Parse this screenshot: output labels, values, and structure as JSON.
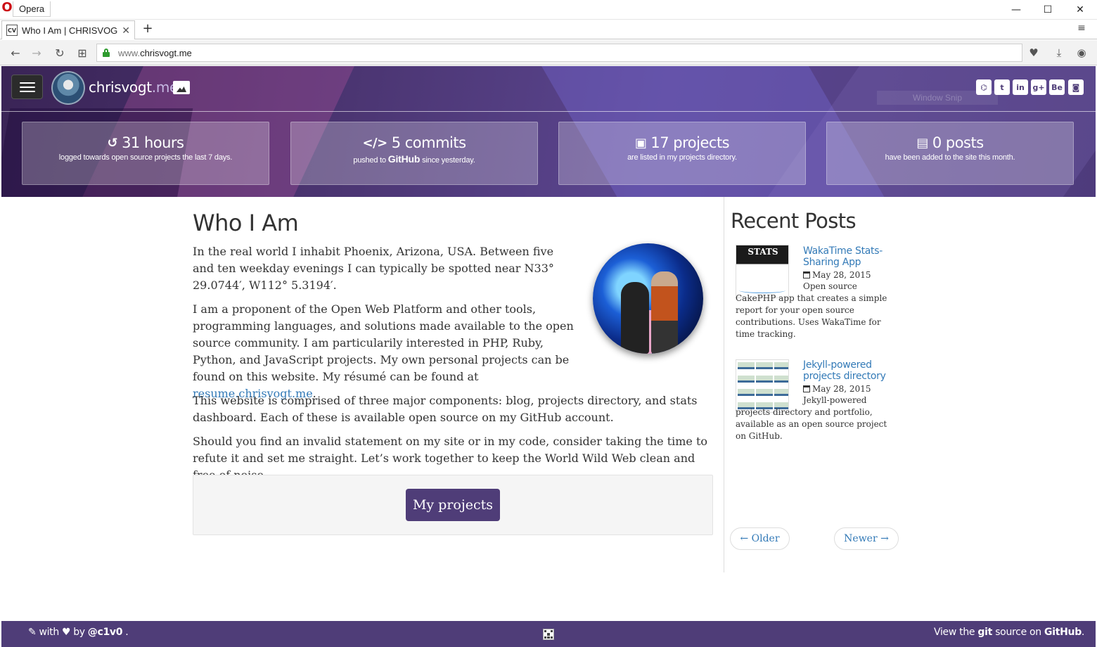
{
  "browser": {
    "app_label": "Opera",
    "tab_title": "Who I Am | CHRISVOGT.me",
    "tab_favicon_text": "CV",
    "url_host": "www.",
    "url_domain": "chrisvogt.me",
    "window_controls": {
      "minimize": "—",
      "maximize": "☐",
      "close": "✕"
    }
  },
  "header": {
    "site_name": "chrisvogt",
    "site_tld": ".me",
    "social_icons": [
      "github-icon",
      "twitter-icon",
      "linkedin-icon",
      "google-plus-icon",
      "behance-icon",
      "instagram-icon"
    ],
    "social_glyphs": [
      "⌬",
      "t",
      "in",
      "g+",
      "Be",
      "◙"
    ],
    "snip_text": "Window Snip",
    "brand_color": "#4f3d78"
  },
  "stats": [
    {
      "icon": "history-icon",
      "glyph": "↺",
      "value": "31 hours",
      "caption": "logged towards open source projects the last 7 days."
    },
    {
      "icon": "code-icon",
      "glyph": "</>",
      "value": "5 commits",
      "caption_before": "pushed to",
      "caption_brand": "GitHub",
      "caption_after": "since yesterday."
    },
    {
      "icon": "save-icon",
      "glyph": "▣",
      "value": "17 projects",
      "caption": "are listed in my projects directory."
    },
    {
      "icon": "newspaper-icon",
      "glyph": "▤",
      "value": "0 posts",
      "caption": "have been added to the site this month."
    }
  ],
  "main": {
    "title": "Who I Am",
    "p1": "In the real world I inhabit Phoenix, Arizona, USA. Between five and ten weekday evenings I can typically be spotted near N33° 29.0744′, W112° 5.3194′.",
    "p2_text": "I am a proponent of the Open Web Platform and other tools, programming languages, and solutions made available to the open source community. I am particularily interested in PHP, Ruby, Python, and JavaScript projects. My own personal projects can be found on this website. My résumé can be found at",
    "p2_link": "resume.chrisvogt.me",
    "p2_end": ".",
    "p3": "This website is comprised of three major components: blog, projects directory, and stats dashboard. Each of these is available open source on my GitHub account.",
    "p4": "Should you find an invalid statement on my site or in my code, consider taking the time to refute it and set me straight. Let’s work together to keep the World Wild Web clean and free of noise.",
    "projects_button": "My projects"
  },
  "sidebar": {
    "title": "Recent Posts",
    "posts": [
      {
        "title": "WakaTime Stats-Sharing App",
        "date": "May 28, 2015",
        "excerpt_top": "Open source CakePHP app that",
        "excerpt_rest": "creates a simple report for your open source contributions. Uses WakaTime for time tracking.",
        "thumb_text": "STATS"
      },
      {
        "title": "Jekyll-powered projects directory",
        "date": "May 28, 2015",
        "excerpt_top": "Jekyll-powered projects directory",
        "excerpt_rest": "and portfolio, available as an open source project on GitHub."
      }
    ],
    "older": "← Older",
    "newer": "Newer →"
  },
  "footer": {
    "left_with": "with",
    "left_by": "by",
    "left_handle": "@c1v0",
    "left_end": ".",
    "right_before": "View the",
    "right_git": "git",
    "right_mid": "source on",
    "right_brand": "GitHub",
    "right_end": "."
  }
}
